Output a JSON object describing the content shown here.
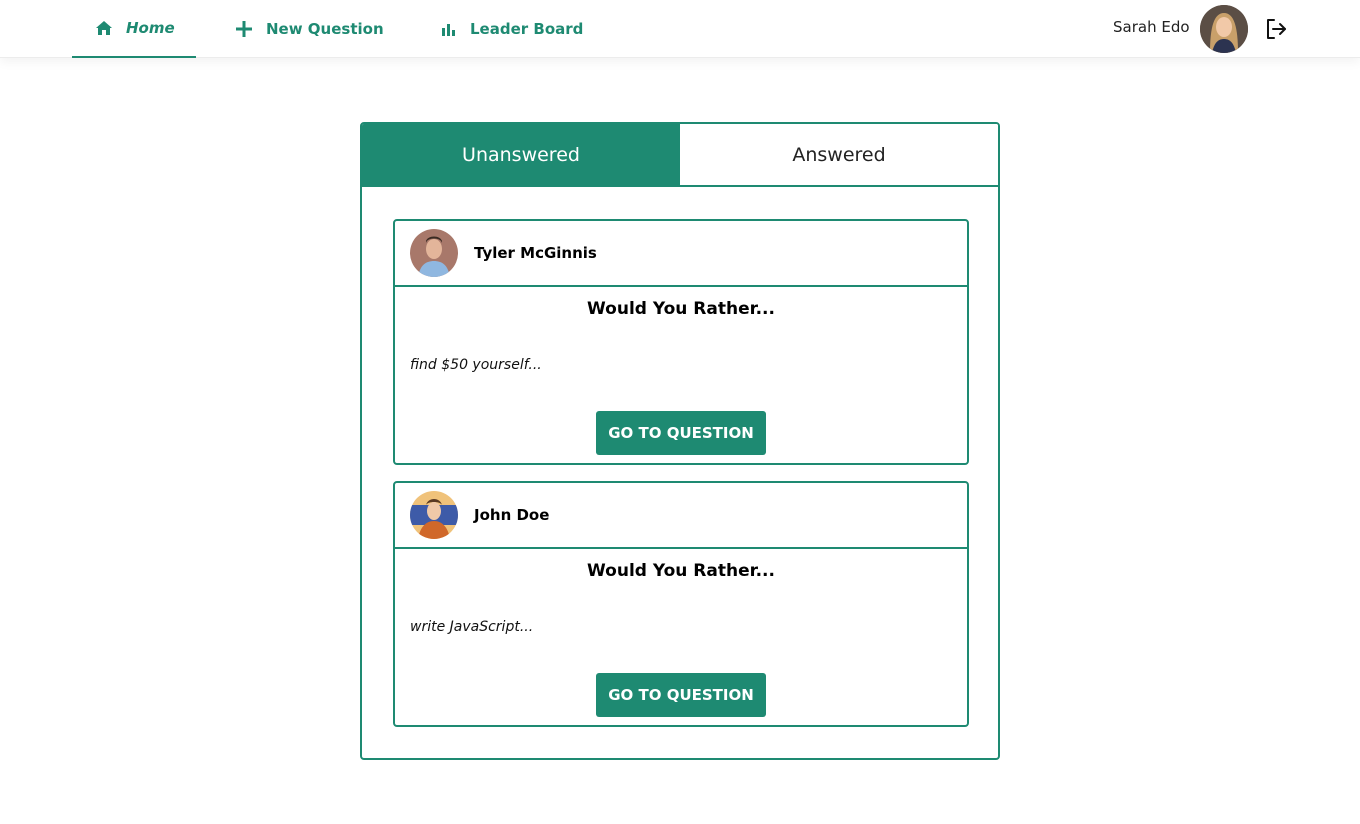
{
  "nav": {
    "items": [
      {
        "label": "Home",
        "icon": "home-icon"
      },
      {
        "label": "New Question",
        "icon": "plus-icon"
      },
      {
        "label": "Leader Board",
        "icon": "bar-chart-icon"
      }
    ],
    "user_name": "Sarah Edo",
    "logout_icon": "logout-icon"
  },
  "tabs": [
    {
      "label": "Unanswered",
      "active": true
    },
    {
      "label": "Answered",
      "active": false
    }
  ],
  "questions": [
    {
      "author": "Tyler McGinnis",
      "heading": "Would You Rather...",
      "option": "find $50 yourself...",
      "button": "GO TO QUESTION"
    },
    {
      "author": "John Doe",
      "heading": "Would You Rather...",
      "option": "write JavaScript...",
      "button": "GO TO QUESTION"
    }
  ],
  "colors": {
    "accent": "#1e8a72",
    "background": "#ffffff"
  }
}
